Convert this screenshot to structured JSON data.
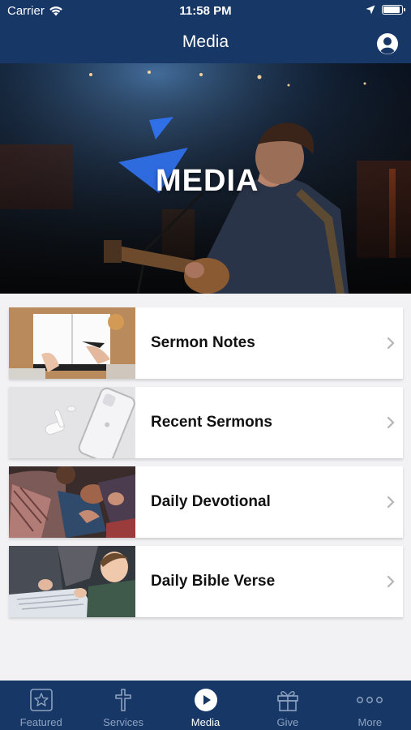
{
  "status": {
    "carrier": "Carrier",
    "time": "11:58 PM",
    "battery_level": 0.9
  },
  "header": {
    "title": "Media"
  },
  "hero": {
    "title": "MEDIA"
  },
  "items": [
    {
      "label": "Sermon Notes",
      "thumb": "notebook-writing"
    },
    {
      "label": "Recent Sermons",
      "thumb": "phone-earbuds"
    },
    {
      "label": "Daily Devotional",
      "thumb": "people-praying"
    },
    {
      "label": "Daily Bible Verse",
      "thumb": "child-reading-bible"
    }
  ],
  "tabs": [
    {
      "label": "Featured",
      "icon": "star-icon",
      "active": false
    },
    {
      "label": "Services",
      "icon": "cross-icon",
      "active": false
    },
    {
      "label": "Media",
      "icon": "play-icon",
      "active": true
    },
    {
      "label": "Give",
      "icon": "gift-icon",
      "active": false
    },
    {
      "label": "More",
      "icon": "more-icon",
      "active": false
    }
  ],
  "colors": {
    "nav": "#173767",
    "accent": "#2f6fe8",
    "background": "#f2f2f4"
  }
}
